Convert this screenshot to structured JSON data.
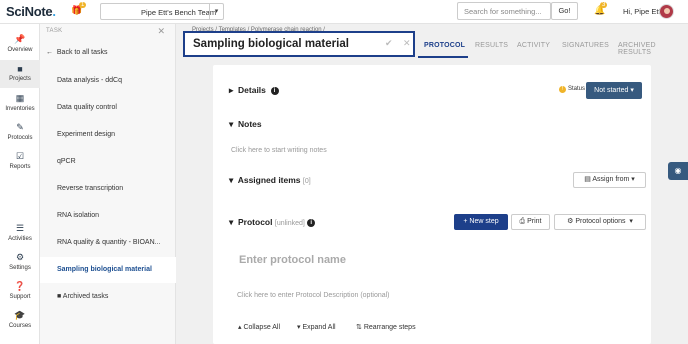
{
  "header": {
    "logo_main": "SciNote",
    "gift_badge": "1",
    "team": "Pipe Ett's Bench Team",
    "search_placeholder": "Search for something...",
    "go": "Go!",
    "notif_badge": "3",
    "greeting": "Hi, Pipe Ett"
  },
  "leftnav": {
    "items": [
      {
        "label": "Overview",
        "icon": "pin-icon"
      },
      {
        "label": "Projects",
        "icon": "folder-icon"
      },
      {
        "label": "Inventories",
        "icon": "table-icon"
      },
      {
        "label": "Protocols",
        "icon": "edit-icon"
      },
      {
        "label": "Reports",
        "icon": "checklist-icon"
      },
      {
        "label": "Activities",
        "icon": "list-icon"
      },
      {
        "label": "Settings",
        "icon": "gear-icon"
      },
      {
        "label": "Support",
        "icon": "question-icon"
      },
      {
        "label": "Courses",
        "icon": "graduation-icon"
      }
    ]
  },
  "tasks": {
    "header": "TASK",
    "back": "Back to all tasks",
    "items": [
      "Data analysis - ddCq",
      "Data quality control",
      "Experiment design",
      "qPCR",
      "Reverse transcription",
      "RNA isolation",
      "RNA quality & quantity - BIOAN...",
      "Sampling biological material"
    ],
    "archived": "Archived tasks"
  },
  "main": {
    "breadcrumb": "Projects  /  Templates  /  Polymerase chain reaction  /",
    "title": "Sampling biological material",
    "tabs": [
      "PROTOCOL",
      "RESULTS",
      "ACTIVITY",
      "SIGNATURES",
      "ARCHIVED RESULTS"
    ],
    "details": "Details",
    "status_label": "Status",
    "status_value": "Not started",
    "notes": "Notes",
    "notes_placeholder": "Click here to start writing notes",
    "assigned": "Assigned items",
    "assigned_count": "[0]",
    "assign_from": "Assign from",
    "protocol": "Protocol",
    "protocol_state": "[unlinked]",
    "new_step": "New step",
    "print": "Print",
    "protocol_options": "Protocol options",
    "protocol_name_placeholder": "Enter protocol name",
    "protocol_desc_placeholder": "Click here to enter Protocol Description (optional)",
    "collapse_all": "Collapse All",
    "expand_all": "Expand All",
    "rearrange": "Rearrange steps"
  }
}
